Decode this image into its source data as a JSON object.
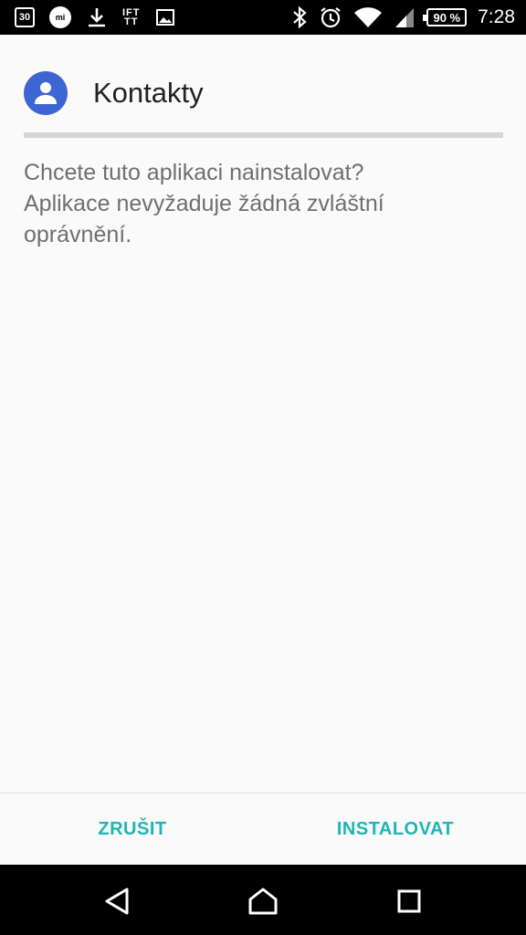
{
  "status_bar": {
    "calendar_day": "30",
    "mi_label": "mi",
    "ifttt_label": "IFT\nTT",
    "battery": "90 %",
    "time": "7:28",
    "icons": [
      "calendar-icon",
      "mi-icon",
      "download-icon",
      "ifttt-icon",
      "image-icon",
      "bluetooth-icon",
      "alarm-icon",
      "wifi-icon",
      "signal-icon",
      "battery-icon"
    ]
  },
  "header": {
    "app_name": "Kontakty",
    "icon": "contacts-person-icon",
    "icon_color": "#3e66d2"
  },
  "message": {
    "line1": "Chcete tuto aplikaci nainstalovat?",
    "line2": "Aplikace nevyžaduje žádná zvláštní",
    "line3": "oprávnění."
  },
  "buttons": {
    "cancel": "ZRUŠIT",
    "install": "INSTALOVAT",
    "accent_color": "#1fb5b5"
  },
  "nav_bar": {
    "icons": [
      "back-icon",
      "home-icon",
      "recents-icon"
    ]
  }
}
